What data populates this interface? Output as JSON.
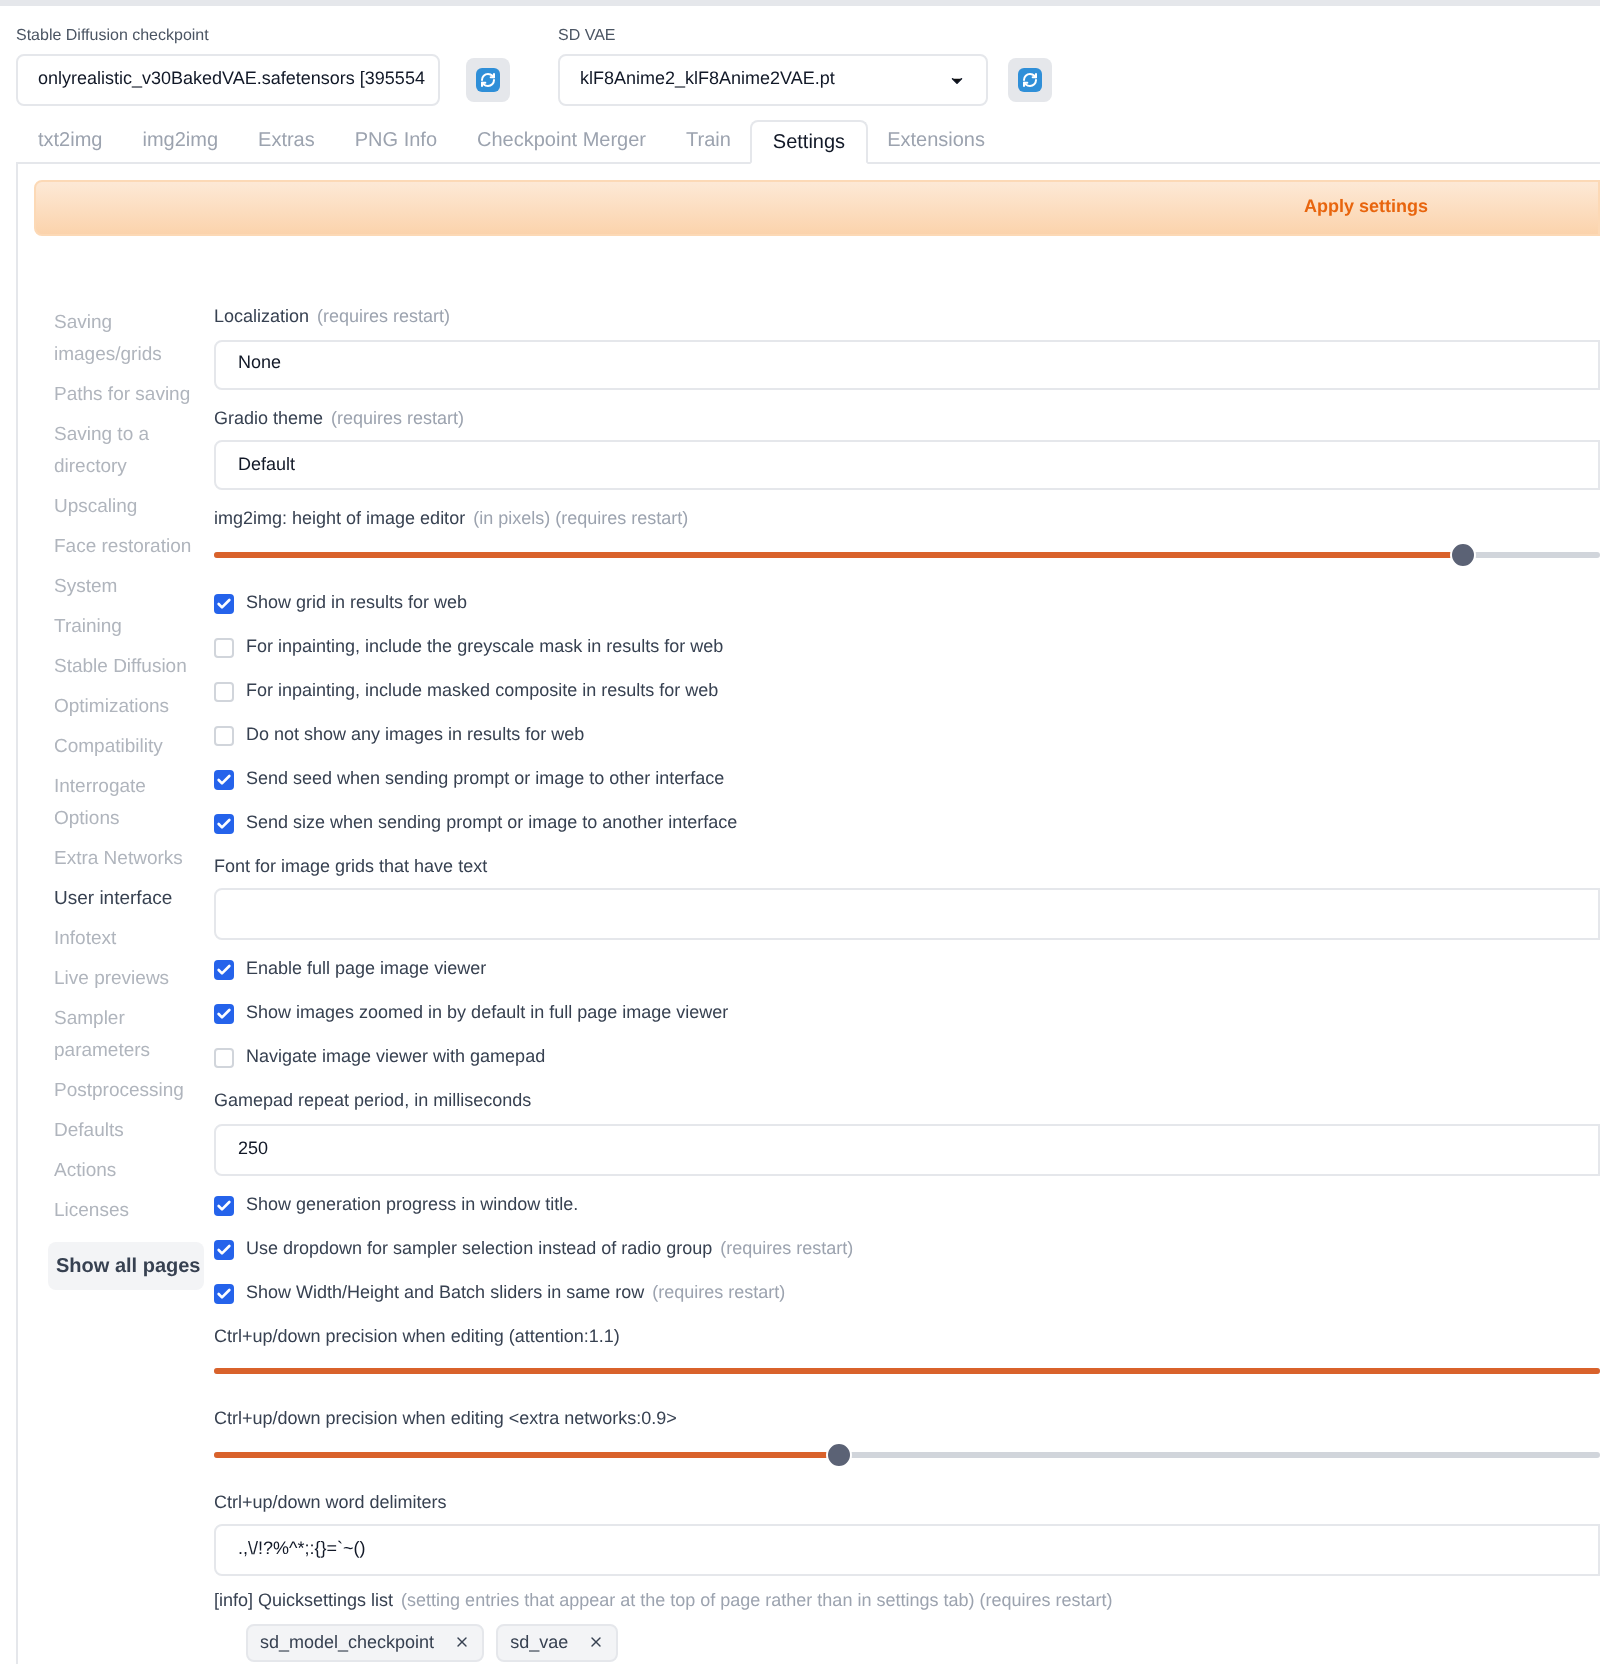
{
  "checkpoint": {
    "label": "Stable Diffusion checkpoint",
    "value": "onlyrealistic_v30BakedVAE.safetensors [395554"
  },
  "vae": {
    "label": "SD VAE",
    "value": "klF8Anime2_klF8Anime2VAE.pt"
  },
  "tabs": [
    {
      "label": "txt2img",
      "selected": false
    },
    {
      "label": "img2img",
      "selected": false
    },
    {
      "label": "Extras",
      "selected": false
    },
    {
      "label": "PNG Info",
      "selected": false
    },
    {
      "label": "Checkpoint Merger",
      "selected": false
    },
    {
      "label": "Train",
      "selected": false
    },
    {
      "label": "Settings",
      "selected": true
    },
    {
      "label": "Extensions",
      "selected": false
    }
  ],
  "apply_button": "Apply settings",
  "sidebar": {
    "items": [
      {
        "label": "Saving images/grids",
        "selected": false
      },
      {
        "label": "Paths for saving",
        "selected": false
      },
      {
        "label": "Saving to a directory",
        "selected": false
      },
      {
        "label": "Upscaling",
        "selected": false
      },
      {
        "label": "Face restoration",
        "selected": false
      },
      {
        "label": "System",
        "selected": false
      },
      {
        "label": "Training",
        "selected": false
      },
      {
        "label": "Stable Diffusion",
        "selected": false
      },
      {
        "label": "Optimizations",
        "selected": false
      },
      {
        "label": "Compatibility",
        "selected": false
      },
      {
        "label": "Interrogate Options",
        "selected": false
      },
      {
        "label": "Extra Networks",
        "selected": false
      },
      {
        "label": "User interface",
        "selected": true
      },
      {
        "label": "Infotext",
        "selected": false
      },
      {
        "label": "Live previews",
        "selected": false
      },
      {
        "label": "Sampler parameters",
        "selected": false
      },
      {
        "label": "Postprocessing",
        "selected": false
      },
      {
        "label": "Defaults",
        "selected": false
      },
      {
        "label": "Actions",
        "selected": false
      },
      {
        "label": "Licenses",
        "selected": false
      }
    ],
    "show_all_button": "Show all pages"
  },
  "settings": [
    {
      "kind": "dropdown",
      "label": "Localization",
      "note": "(requires restart)",
      "value": "None"
    },
    {
      "kind": "dropdown",
      "label": "Gradio theme",
      "note": "(requires restart)",
      "value": "Default"
    },
    {
      "kind": "slider",
      "label": "img2img: height of image editor",
      "note": "(in pixels) (requires restart)",
      "level": 0.9
    },
    {
      "kind": "checkbox",
      "label": "Show grid in results for web",
      "checked": true
    },
    {
      "kind": "checkbox",
      "label": "For inpainting, include the greyscale mask in results for web",
      "checked": false
    },
    {
      "kind": "checkbox",
      "label": "For inpainting, include masked composite in results for web",
      "checked": false
    },
    {
      "kind": "checkbox",
      "label": "Do not show any images in results for web",
      "checked": false
    },
    {
      "kind": "checkbox",
      "label": "Send seed when sending prompt or image to other interface",
      "checked": true
    },
    {
      "kind": "checkbox",
      "label": "Send size when sending prompt or image to another interface",
      "checked": true
    },
    {
      "kind": "text",
      "label": "Font for image grids that have text"
    },
    {
      "kind": "checkbox",
      "label": "Enable full page image viewer",
      "checked": true
    },
    {
      "kind": "checkbox",
      "label": "Show images zoomed in by default in full page image viewer",
      "checked": true
    },
    {
      "kind": "checkbox",
      "label": "Navigate image viewer with gamepad",
      "checked": false
    },
    {
      "kind": "text",
      "label": "Gamepad repeat period, in milliseconds",
      "value": "250"
    },
    {
      "kind": "checkbox",
      "label": "Show generation progress in window title.",
      "checked": true
    },
    {
      "kind": "checkbox",
      "label": "Use dropdown for sampler selection instead of radio group",
      "note": "(requires restart)",
      "checked": true
    },
    {
      "kind": "checkbox",
      "label": "Show Width/Height and Batch sliders in same row",
      "note": "(requires restart)",
      "checked": true
    },
    {
      "kind": "slider",
      "label": "Ctrl+up/down precision when editing (attention:1.1)",
      "level": 1
    },
    {
      "kind": "slider",
      "label": "Ctrl+up/down precision when editing <extra networks:0.9>",
      "level": 0.45
    },
    {
      "kind": "text",
      "label": "Ctrl+up/down word delimiters",
      "value": ".,\\/!?%^*;:{}=`~()"
    },
    {
      "kind": "chips",
      "label": "[info] Quicksettings list",
      "note": "(setting entries that appear at the top of page rather than in settings tab) (requires restart)",
      "chips": [
        "sd_model_checkpoint",
        "sd_vae"
      ]
    }
  ]
}
